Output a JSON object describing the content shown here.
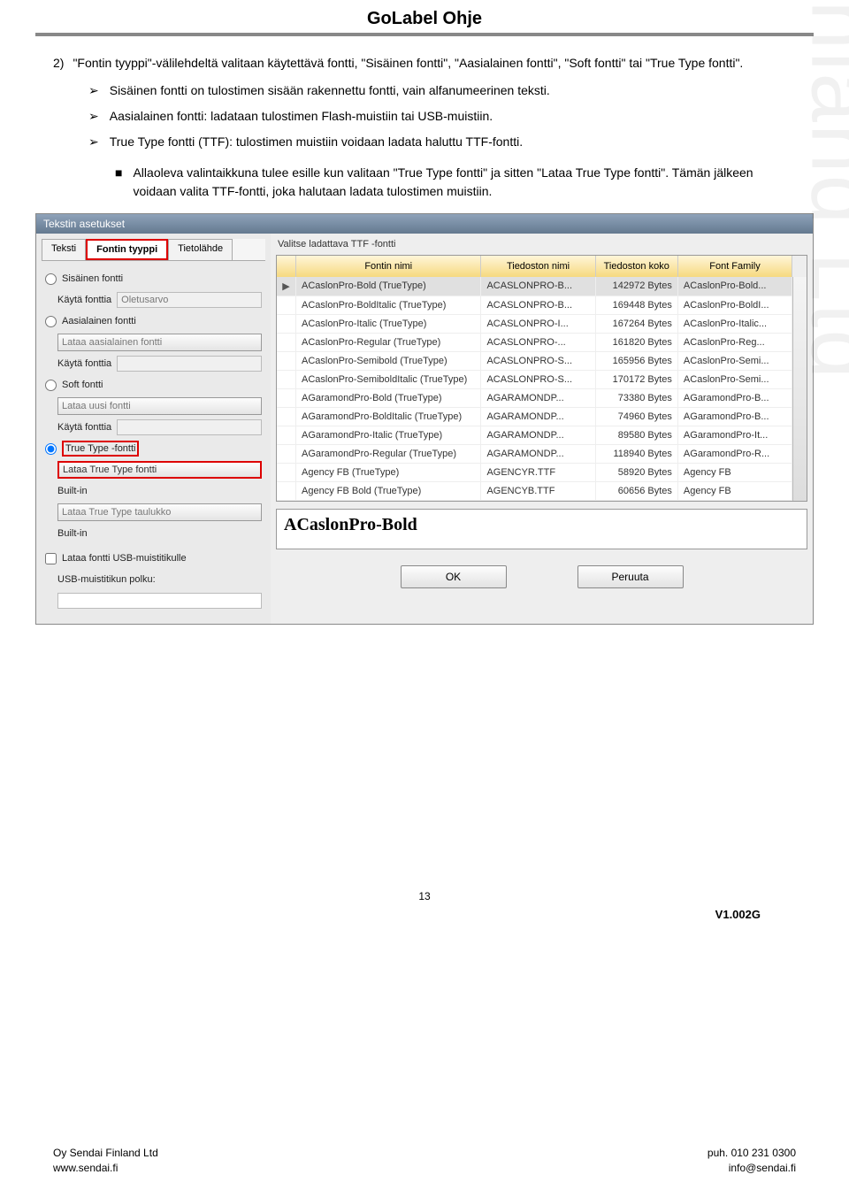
{
  "header": {
    "title": "GoLabel Ohje"
  },
  "watermark": "Oy Sendai Finland Ltd",
  "text": {
    "item_num": "2)",
    "item_body": "\"Fontin tyyppi\"-välilehdeltä valitaan käytettävä fontti, \"Sisäinen fontti\", \"Aasialainen fontti\", \"Soft fontti\" tai \"True Type fontti\".",
    "b1": "Sisäinen fontti on tulostimen sisään rakennettu fontti, vain alfanumeerinen teksti.",
    "b2": "Aasialainen fontti: ladataan tulostimen Flash-muistiin tai USB-muistiin.",
    "b3": "True Type fontti (TTF): tulostimen muistiin voidaan ladata haluttu TTF-fontti.",
    "sq1": "Allaoleva valintaikkuna tulee esille kun valitaan \"True Type fontti\" ja sitten \"Lataa True Type fontti\". Tämän jälkeen voidaan valita TTF-fontti, joka halutaan ladata tulostimen muistiin.",
    "arrow": "➢",
    "square": "■"
  },
  "dialog": {
    "title": "Tekstin asetukset",
    "tabs": {
      "teksti": "Teksti",
      "fontin": "Fontin tyyppi",
      "tieto": "Tietolähde"
    },
    "opts": {
      "sisainen": "Sisäinen fontti",
      "kaytafonttia": "Käytä fonttia",
      "oletusarvo": "Oletusarvo",
      "aasialainen": "Aasialainen fontti",
      "lataa_aas": "Lataa aasialainen fontti",
      "soft": "Soft fontti",
      "lataa_uusi": "Lataa uusi fontti",
      "truetype": "True Type -fontti",
      "lataa_tt": "Lataa True Type fontti",
      "builtin": "Built-in",
      "lataa_tt_taulukko": "Lataa True Type taulukko",
      "lataa_usb": "Lataa fontti USB-muistitikulle",
      "usb_polku": "USB-muistitikun polku:"
    },
    "right_title": "Valitse ladattava TTF -fontti",
    "columns": {
      "fn": "Fontin nimi",
      "tn": "Tiedoston nimi",
      "sz": "Tiedoston koko",
      "ff": "Font Family"
    },
    "rows": [
      {
        "fn": "ACaslonPro-Bold (TrueType)",
        "tn": "ACASLONPRO-B...",
        "sz": "142972 Bytes",
        "ff": "ACaslonPro-Bold..."
      },
      {
        "fn": "ACaslonPro-BoldItalic (TrueType)",
        "tn": "ACASLONPRO-B...",
        "sz": "169448 Bytes",
        "ff": "ACaslonPro-BoldI..."
      },
      {
        "fn": "ACaslonPro-Italic (TrueType)",
        "tn": "ACASLONPRO-I...",
        "sz": "167264 Bytes",
        "ff": "ACaslonPro-Italic..."
      },
      {
        "fn": "ACaslonPro-Regular (TrueType)",
        "tn": "ACASLONPRO-...",
        "sz": "161820 Bytes",
        "ff": "ACaslonPro-Reg..."
      },
      {
        "fn": "ACaslonPro-Semibold (TrueType)",
        "tn": "ACASLONPRO-S...",
        "sz": "165956 Bytes",
        "ff": "ACaslonPro-Semi..."
      },
      {
        "fn": "ACaslonPro-SemiboldItalic (TrueType)",
        "tn": "ACASLONPRO-S...",
        "sz": "170172 Bytes",
        "ff": "ACaslonPro-Semi..."
      },
      {
        "fn": "AGaramondPro-Bold (TrueType)",
        "tn": "AGARAMONDP...",
        "sz": "73380 Bytes",
        "ff": "AGaramondPro-B..."
      },
      {
        "fn": "AGaramondPro-BoldItalic (TrueType)",
        "tn": "AGARAMONDP...",
        "sz": "74960 Bytes",
        "ff": "AGaramondPro-B..."
      },
      {
        "fn": "AGaramondPro-Italic (TrueType)",
        "tn": "AGARAMONDP...",
        "sz": "89580 Bytes",
        "ff": "AGaramondPro-It..."
      },
      {
        "fn": "AGaramondPro-Regular (TrueType)",
        "tn": "AGARAMONDP...",
        "sz": "118940 Bytes",
        "ff": "AGaramondPro-R..."
      },
      {
        "fn": "Agency FB (TrueType)",
        "tn": "AGENCYR.TTF",
        "sz": "58920 Bytes",
        "ff": "Agency FB"
      },
      {
        "fn": "Agency FB Bold (TrueType)",
        "tn": "AGENCYB.TTF",
        "sz": "60656 Bytes",
        "ff": "Agency FB"
      }
    ],
    "preview": "ACaslonPro-Bold",
    "ok": "OK",
    "cancel": "Peruuta"
  },
  "page": {
    "num": "13",
    "ver": "V1.002G"
  },
  "footer": {
    "l1": "Oy Sendai Finland Ltd",
    "l2": "www.sendai.fi",
    "r1": "puh. 010 231 0300",
    "r2": "info@sendai.fi"
  }
}
